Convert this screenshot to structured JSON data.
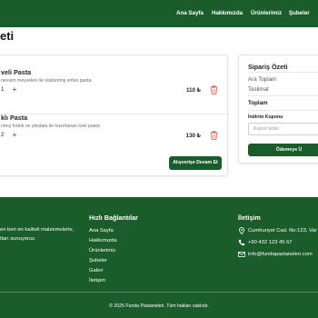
{
  "nav": {
    "items": [
      {
        "label": "Ana Sayfa"
      },
      {
        "label": "Hakkımızda"
      },
      {
        "label": "Ürünlerimiz"
      },
      {
        "label": "Şubeler"
      }
    ]
  },
  "page": {
    "title": "eti"
  },
  "cart": {
    "items": [
      {
        "name": "veli Pasta",
        "description": "nevsim meyveleri ile süslenmiş enfes pasta",
        "quantity": "1",
        "plus": "+",
        "price": "110 ₺"
      },
      {
        "name": "klı Pasta",
        "description": "nmış fındık ve çikolata ile hazırlanan özel pasta",
        "quantity": "2",
        "plus": "+",
        "price": "130 ₺"
      }
    ],
    "continue_label": "Alışverişe Devam Et"
  },
  "summary": {
    "title": "Sipariş Özeti",
    "subtotal_label": "Ara Toplam",
    "shipping_label": "Teslimat",
    "total_label": "Toplam",
    "coupon_label": "İndirim Kuponu",
    "coupon_placeholder": "Kupon kodu",
    "checkout_label": "Ödemeye Ü"
  },
  "footer": {
    "about_line1": "en beri en kaliteli malzemelerle,",
    "about_line2": "tları sunuyoruz.",
    "links_heading": "Hızlı Bağlantılar",
    "links": [
      {
        "label": "Ana Sayfa"
      },
      {
        "label": "Hakkımızda"
      },
      {
        "label": "Ürünlerimiz"
      },
      {
        "label": "Şubeler"
      },
      {
        "label": "Galeri"
      },
      {
        "label": "İletişim"
      }
    ],
    "contact_heading": "İletişim",
    "address": "Cumhuriyet Cad. No:123, Var",
    "phone": "+90 432 123 45 67",
    "email": "info@fundapastaneleri.com",
    "copyright": "© 2025 Funda Pastaneleri. Tüm hakları saklıdır."
  },
  "theme": {
    "primary": "#1a5c2a",
    "danger": "#d9534f"
  },
  "icons": {
    "trash": "trash-icon",
    "plus": "plus-icon",
    "location": "map-pin-icon",
    "phone": "phone-icon",
    "email": "envelope-icon"
  }
}
